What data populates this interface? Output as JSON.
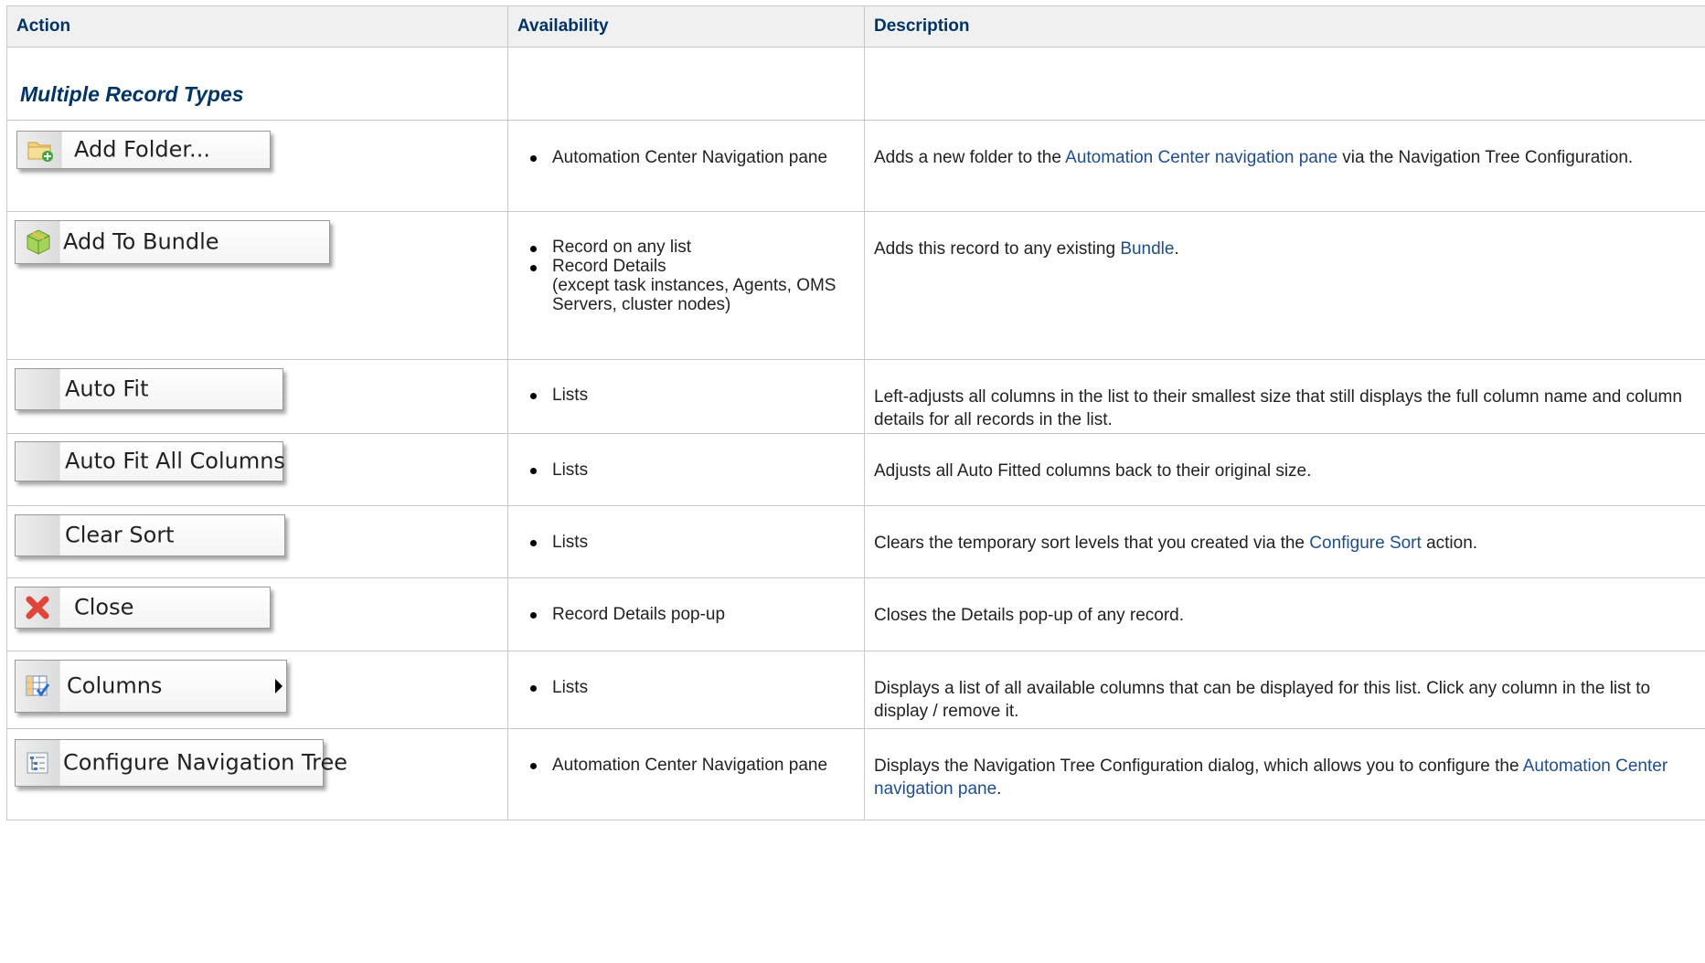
{
  "headers": {
    "action": "Action",
    "availability": "Availability",
    "description": "Description"
  },
  "section_title": "Multiple Record Types",
  "rows": [
    {
      "button": {
        "label": "Add Folder...",
        "icon": "folder-add-icon"
      },
      "availability": [
        "Automation Center Navigation pane"
      ],
      "description": {
        "pre": "Adds a new folder to the ",
        "link": "Automation Center navigation pane",
        "post": " via the Navigation Tree Configuration."
      }
    },
    {
      "button": {
        "label": "Add To Bundle",
        "icon": "bundle-cube-icon"
      },
      "availability": [
        "Record on any list",
        "Record Details\n(except task instances, Agents, OMS Servers, cluster nodes)"
      ],
      "description": {
        "pre": "Adds this record to any existing ",
        "link": "Bundle",
        "post": "."
      }
    },
    {
      "button": {
        "label": "Auto Fit",
        "icon": ""
      },
      "availability": [
        "Lists"
      ],
      "description": {
        "pre": "Left-adjusts all columns in the list to their smallest size that still displays the full column name and column details for all records in the list.",
        "link": "",
        "post": ""
      }
    },
    {
      "button": {
        "label": "Auto Fit All Columns",
        "icon": ""
      },
      "availability": [
        "Lists"
      ],
      "description": {
        "pre": "Adjusts all Auto Fitted columns back to their original size.",
        "link": "",
        "post": ""
      }
    },
    {
      "button": {
        "label": "Clear Sort",
        "icon": ""
      },
      "availability": [
        "Lists"
      ],
      "description": {
        "pre": "Clears the temporary sort levels that you created via the ",
        "link": "Configure Sort",
        "post": " action."
      }
    },
    {
      "button": {
        "label": "Close",
        "icon": "close-x-icon"
      },
      "availability": [
        "Record Details pop-up"
      ],
      "description": {
        "pre": "Closes the Details pop-up of any record.",
        "link": "",
        "post": ""
      }
    },
    {
      "button": {
        "label": "Columns",
        "icon": "columns-grid-icon"
      },
      "availability": [
        "Lists"
      ],
      "description": {
        "pre": "Displays a list of all available columns that can be displayed for this list. Click any column in the list to display / remove it.",
        "link": "",
        "post": ""
      }
    },
    {
      "button": {
        "label": "Configure Navigation Tree",
        "icon": "navigation-tree-icon"
      },
      "availability": [
        "Automation Center Navigation pane"
      ],
      "description": {
        "pre": "Displays the Navigation Tree Configuration dialog, which allows you to configure the ",
        "link": "Automation Center navigation pane",
        "post": "."
      }
    }
  ]
}
